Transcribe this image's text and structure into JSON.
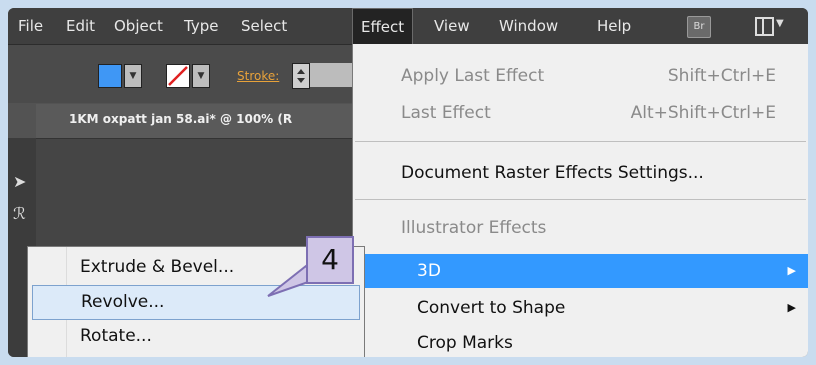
{
  "menubar": {
    "items": [
      "File",
      "Edit",
      "Object",
      "Type",
      "Select",
      "Effect",
      "View",
      "Window",
      "Help"
    ],
    "active": "Effect",
    "bridge_icon": "Br"
  },
  "control_bar": {
    "stroke_label": "Stroke:"
  },
  "document": {
    "tab_title": "1KM oxpatt jan 58.ai* @ 100% (R"
  },
  "effect_menu": {
    "apply_last": {
      "label": "Apply Last Effect",
      "shortcut": "Shift+Ctrl+E"
    },
    "last_effect": {
      "label": "Last Effect",
      "shortcut": "Alt+Shift+Ctrl+E"
    },
    "raster_settings": "Document Raster Effects Settings...",
    "section_header": "Illustrator Effects",
    "items": [
      {
        "label": "3D",
        "has_submenu": true
      },
      {
        "label": "Convert to Shape",
        "has_submenu": true
      },
      {
        "label": "Crop Marks",
        "has_submenu": false
      }
    ]
  },
  "submenu_3d": {
    "items": [
      "Extrude & Bevel...",
      "Revolve...",
      "Rotate..."
    ],
    "hovered": "Revolve..."
  },
  "callout": {
    "number": "4"
  },
  "colors": {
    "accent": "#3399ff",
    "stroke_label": "#e8a23a",
    "fill_swatch": "#3f97f5"
  }
}
